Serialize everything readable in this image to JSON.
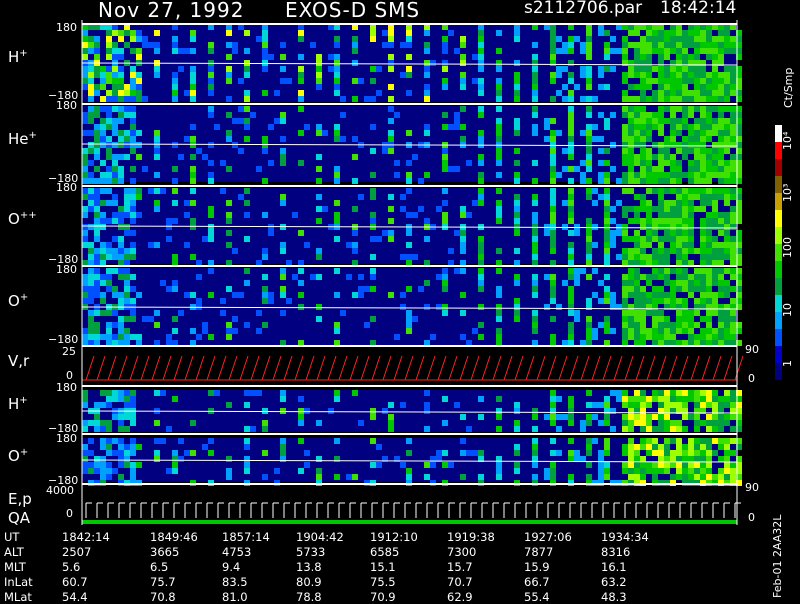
{
  "header": {
    "date": "Nov 27, 1992",
    "instrument": "EXOS-D SMS",
    "file": "s2112706.par",
    "time": "18:42:14"
  },
  "colorbar": {
    "unit": "Ct/Smp",
    "tick_labels": [
      "1",
      "10",
      "100",
      "10³",
      "10⁴"
    ],
    "tick_values": [
      1,
      10,
      100,
      1000,
      10000
    ],
    "scale": "log",
    "colors": [
      "#000080",
      "#0000c8",
      "#0050ff",
      "#00a0ff",
      "#00d8d8",
      "#00a040",
      "#00c800",
      "#40e000",
      "#a0ff00",
      "#ffff00",
      "#c8a000",
      "#806000",
      "#a00000",
      "#ff0000",
      "#ffffff"
    ]
  },
  "chart_data": [
    {
      "type": "heatmap",
      "panel": "H+",
      "label": "H",
      "label_sup": "+",
      "ylim": [
        -180,
        180
      ],
      "y_ticks": [
        "180",
        "−180"
      ],
      "intensity_levels": "spectrogram pitch-angle counts"
    },
    {
      "type": "heatmap",
      "panel": "He+",
      "label": "He",
      "label_sup": "+",
      "ylim": [
        -180,
        180
      ],
      "y_ticks": [
        "180",
        "−180"
      ]
    },
    {
      "type": "heatmap",
      "panel": "O++",
      "label": "O",
      "label_sup": "++",
      "ylim": [
        -180,
        180
      ],
      "y_ticks": [
        "180",
        "−180"
      ]
    },
    {
      "type": "heatmap",
      "panel": "O+",
      "label": "O",
      "label_sup": "+",
      "ylim": [
        -180,
        180
      ],
      "y_ticks": [
        "180",
        "−180"
      ]
    },
    {
      "type": "line",
      "panel": "V,r",
      "label": "V,r",
      "left_ticks": [
        "25",
        "0"
      ],
      "right_ticks": [
        "90",
        "0"
      ]
    },
    {
      "type": "heatmap",
      "panel": "H+ (2)",
      "label": "H",
      "label_sup": "+",
      "ylim": [
        -180,
        180
      ],
      "y_ticks": [
        "180",
        "−180"
      ]
    },
    {
      "type": "heatmap",
      "panel": "O+ (2)",
      "label": "O",
      "label_sup": "+",
      "ylim": [
        -180,
        180
      ],
      "y_ticks": [
        "180",
        "−180"
      ]
    },
    {
      "type": "line",
      "panel": "E,p QA",
      "label": "E,p",
      "label2": "QA",
      "left_ticks": [
        "4000",
        "0"
      ],
      "right_ticks": [
        "90",
        "0"
      ]
    }
  ],
  "table": {
    "row_labels": [
      "UT",
      "ALT",
      "MLT",
      "InLat",
      "MLat"
    ],
    "columns": [
      {
        "UT": "1842:14",
        "ALT": "2507",
        "MLT": "5.6",
        "InLat": "60.7",
        "MLat": "54.4"
      },
      {
        "UT": "1849:46",
        "ALT": "3665",
        "MLT": "6.5",
        "InLat": "75.7",
        "MLat": "70.8"
      },
      {
        "UT": "1857:14",
        "ALT": "4753",
        "MLT": "9.4",
        "InLat": "83.5",
        "MLat": "81.0"
      },
      {
        "UT": "1904:42",
        "ALT": "5733",
        "MLT": "13.8",
        "InLat": "80.9",
        "MLat": "78.8"
      },
      {
        "UT": "1912:10",
        "ALT": "6585",
        "MLT": "15.1",
        "InLat": "75.5",
        "MLat": "70.9"
      },
      {
        "UT": "1919:38",
        "ALT": "7300",
        "MLT": "15.7",
        "InLat": "70.7",
        "MLat": "62.9"
      },
      {
        "UT": "1927:06",
        "ALT": "7877",
        "MLT": "15.9",
        "InLat": "66.7",
        "MLat": "55.4"
      },
      {
        "UT": "1934:34",
        "ALT": "8316",
        "MLT": "16.1",
        "InLat": "63.2",
        "MLat": "48.3"
      }
    ]
  },
  "side_note": "Feb-01 2AA32L"
}
